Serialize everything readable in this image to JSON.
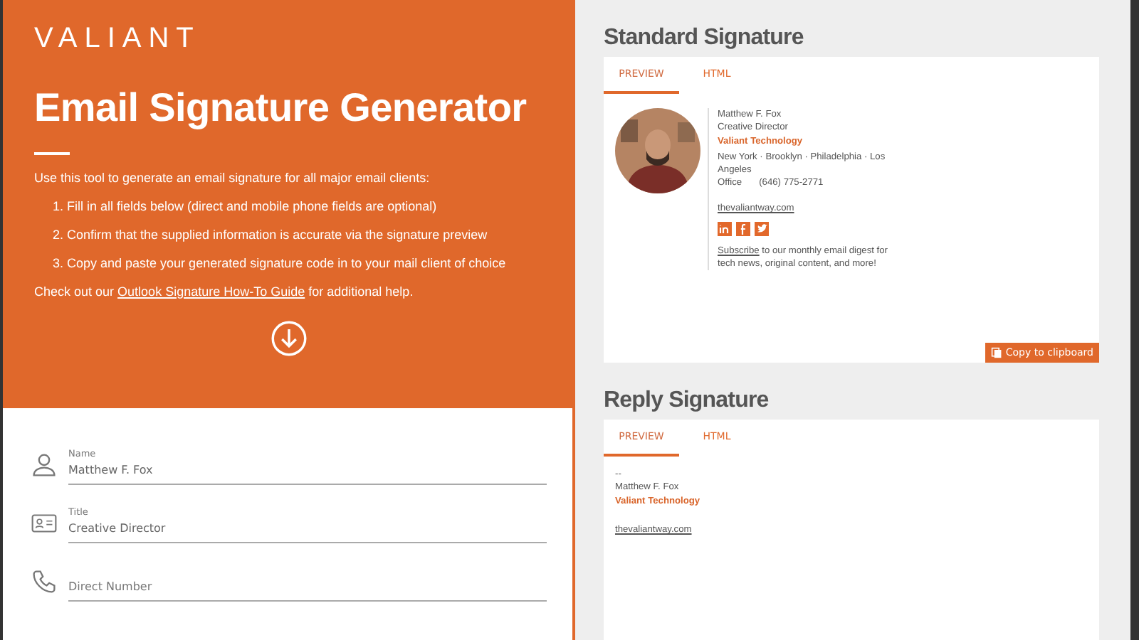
{
  "logo": "VALIANT",
  "hero": {
    "title": "Email Signature Generator",
    "intro": "Use this tool to generate an email signature for all major email clients:",
    "steps": [
      "1. Fill in all fields below (direct and mobile phone fields are optional)",
      "2. Confirm that the supplied information is accurate via the signature preview",
      "3. Copy and paste your generated signature code in to your mail client of choice"
    ],
    "help_before": "Check out our",
    "help_link": "Outlook Signature How-To Guide",
    "help_after": "for additional help."
  },
  "fields": [
    {
      "label": "Name",
      "value": "Matthew F. Fox"
    },
    {
      "label": "Title",
      "value": "Creative Director"
    },
    {
      "placeholder": "Direct Number"
    }
  ],
  "standard": {
    "heading": "Standard Signature",
    "tabs": [
      {
        "label": "PREVIEW",
        "selected": true
      },
      {
        "label": "HTML",
        "selected": false
      }
    ],
    "name": "Matthew F. Fox",
    "title": "Creative Director",
    "company": "Valiant Technology",
    "locations": "New York · Brooklyn · Philadelphia · Los Angeles",
    "phone_label": "Office",
    "phone": "(646) 775-2771",
    "website": "thevaliantway.com",
    "subscribe_link": "Subscribe",
    "subscribe_text": "to our monthly email digest for tech news, original content, and more!",
    "copy_button": "Copy to clipboard"
  },
  "reply": {
    "heading": "Reply Signature",
    "tabs": [
      {
        "label": "PREVIEW",
        "selected": true
      },
      {
        "label": "HTML",
        "selected": false
      }
    ],
    "dashes": "--",
    "name": "Matthew F. Fox",
    "company": "Valiant Technology",
    "website": "thevaliantway.com"
  }
}
